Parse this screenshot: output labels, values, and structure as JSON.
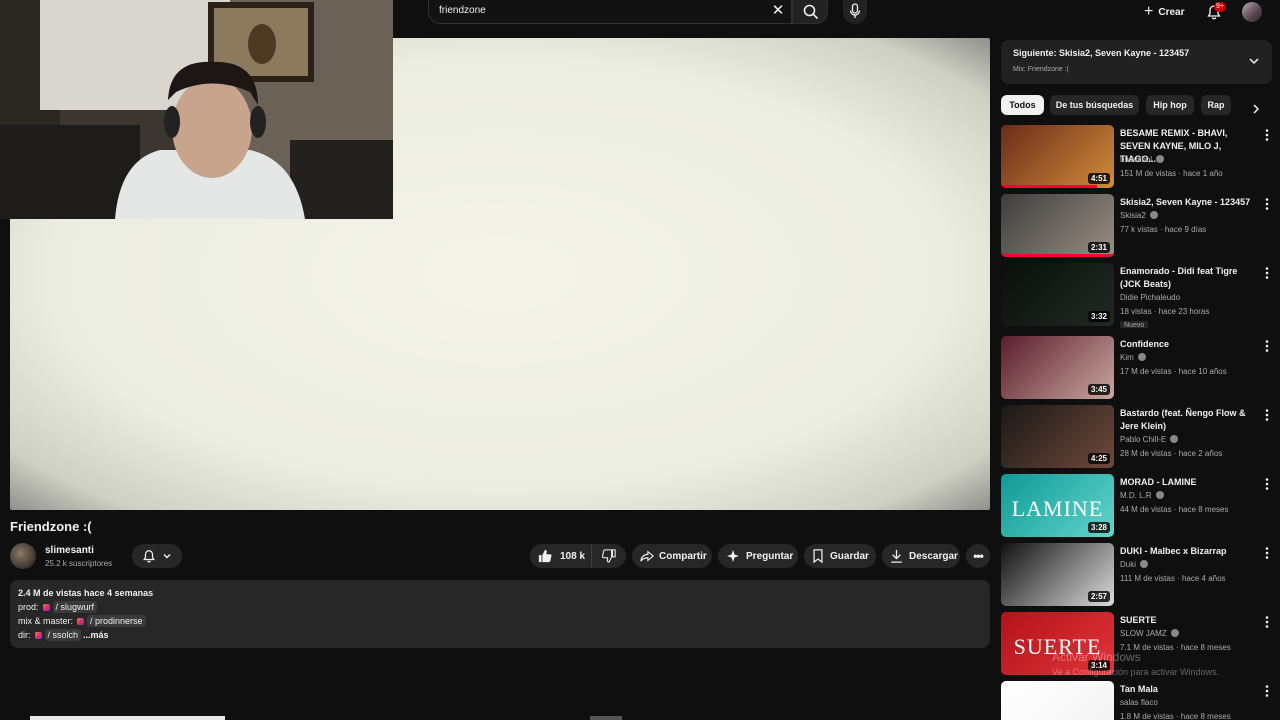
{
  "search": {
    "query": "friendzone"
  },
  "header": {
    "create_label": "Crear",
    "notifications_badge": "9+"
  },
  "video": {
    "title": "Friendzone :(",
    "channel": "slimesanti",
    "subscribers": "25.2 k suscriptores",
    "likes": "108 k",
    "actions": {
      "share": "Compartir",
      "ask": "Preguntar",
      "save": "Guardar",
      "download": "Descargar"
    }
  },
  "description": {
    "stats": "2.4 M de vistas  hace 4 semanas",
    "prod_label": "prod:",
    "prod_handle": "/ slugwurf",
    "mix_label": "mix & master:",
    "mix_handle": "/ prodinnerse",
    "dir_label": "dir:",
    "dir_handle": "/ ssolch",
    "more": "...más"
  },
  "up_next": {
    "title": "Siguiente: Skisia2, Seven Kayne - 123457",
    "mix": "Mix: Friendzone :("
  },
  "chips": [
    "Todos",
    "De tus búsquedas",
    "Hip hop",
    "Rap"
  ],
  "recommendations": [
    {
      "title": "BESAME REMIX - BHAVI, SEVEN KAYNE, MILO J, TIAGO...",
      "channel": "bhavitbol",
      "verified": true,
      "meta": "151 M de vistas · hace 1 año",
      "duration": "4:51",
      "progress": 0.85,
      "colors": [
        "#6a2c1a",
        "#d28d3a"
      ]
    },
    {
      "title": "Skisia2, Seven Kayne - 123457",
      "channel": "Skisia2",
      "verified": true,
      "meta": "77 k vistas · hace 9 días",
      "duration": "2:31",
      "progress": 1,
      "colors": [
        "#3d3d3d",
        "#9a8f84"
      ]
    },
    {
      "title": "Enamorado - Didi feat Tigre (JCK Beats)",
      "channel": "Didie Pichaleudo",
      "verified": false,
      "meta": "18 vistas · hace 23 horas",
      "badge": "Nuevo",
      "duration": "3:32",
      "progress": 0,
      "colors": [
        "#0b0f0c",
        "#1f2a22"
      ]
    },
    {
      "title": "Confidence",
      "channel": "Kim",
      "verified": true,
      "meta": "17 M de vistas · hace 10 años",
      "duration": "3:45",
      "progress": 0,
      "colors": [
        "#5a1d2c",
        "#c9a7a0"
      ]
    },
    {
      "title": "Bastardo (feat. Ñengo Flow & Jere Klein)",
      "channel": "Pablo Chill-E",
      "verified": true,
      "meta": "28 M de vistas · hace 2 años",
      "duration": "4:25",
      "progress": 0,
      "colors": [
        "#1b1816",
        "#6e4a3c"
      ]
    },
    {
      "title": "MORAD - LAMINE",
      "channel": "M.D. L.R",
      "verified": true,
      "meta": "44 M de vistas · hace 8 meses",
      "duration": "3:28",
      "progress": 0,
      "thumb_text": "LAMINE",
      "colors": [
        "#0f9a96",
        "#63d5cc"
      ]
    },
    {
      "title": "DUKI - Malbec x Bizarrap",
      "channel": "Duki",
      "verified": true,
      "meta": "111 M de vistas · hace 4 años",
      "duration": "2:57",
      "progress": 0,
      "colors": [
        "#111111",
        "#dcdcdc"
      ]
    },
    {
      "title": "SUERTE",
      "channel": "SLOW JAMZ",
      "verified": true,
      "meta": "7.1 M de vistas · hace 8 meses",
      "duration": "3:14",
      "progress": 0,
      "thumb_text": "SUERTE",
      "colors": [
        "#b4131a",
        "#e0343a"
      ]
    },
    {
      "title": "Tan Mala",
      "channel": "salas flaco",
      "verified": false,
      "meta": "1.8 M de vistas · hace 8 meses",
      "duration": "",
      "progress": 0,
      "colors": [
        "#ffffff",
        "#f2f2f2"
      ]
    }
  ],
  "watermark": {
    "title": "Activar Windows",
    "subtitle": "Ve a Configuración para activar Windows."
  }
}
